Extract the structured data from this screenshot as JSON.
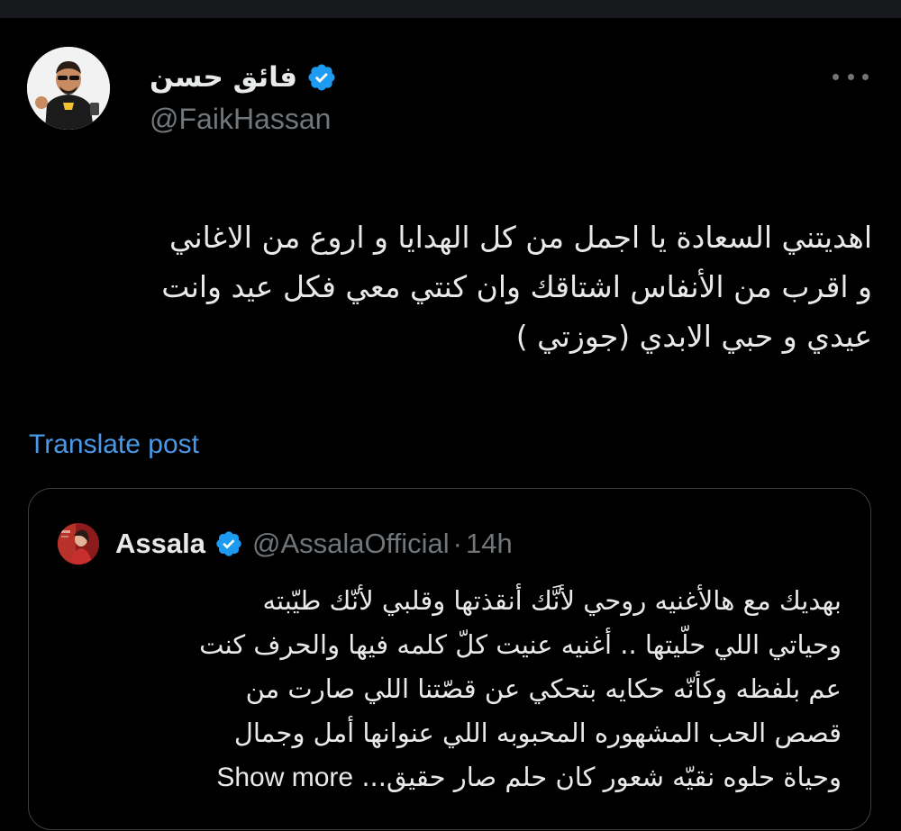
{
  "post": {
    "author": {
      "display_name": "فائق حسن",
      "handle": "@FaikHassan",
      "verified": true,
      "avatar_icon": "avatar-photo"
    },
    "more_icon": "more-horizontal-icon",
    "text_lines": [
      "اهديتني السعادة يا اجمل من كل الهدايا  و اروع من الاغاني",
      "و اقرب من الأنفاس اشتاقك وان كنتي معي فكل عيد وانت",
      "عيدي و حبي الابدي (جوزتي )"
    ],
    "translate_label": "Translate post"
  },
  "quoted_post": {
    "author": {
      "display_name": "Assala",
      "handle": "@AssalaOfficial",
      "separator": "·",
      "time": "14h",
      "verified": true
    },
    "text_lines": [
      "بهديك مع هالأغنيه روحي لأنَّك أنقذتها وقلبي لأنّك طيّبته",
      "وحياتي اللي حلّيتها .. أغنيه عنيت كلّ كلمه فيها والحرف كنت",
      "عم بلفظه وكأنّه حكايه بتحكي عن قصّتنا اللي صارت من",
      "قصص الحب المشهوره المحبوبه اللي عنوانها أمل وجمال",
      "وحياة حلوه نقيّه شعور كان حلم صار حقيق..."
    ],
    "show_more_label": "Show more"
  },
  "colors": {
    "background": "#000000",
    "text_primary": "#e7e9ea",
    "text_secondary": "#71767b",
    "link": "#4a99e9",
    "verified_badge": "#1d9bf0",
    "border": "#3b3f45"
  }
}
